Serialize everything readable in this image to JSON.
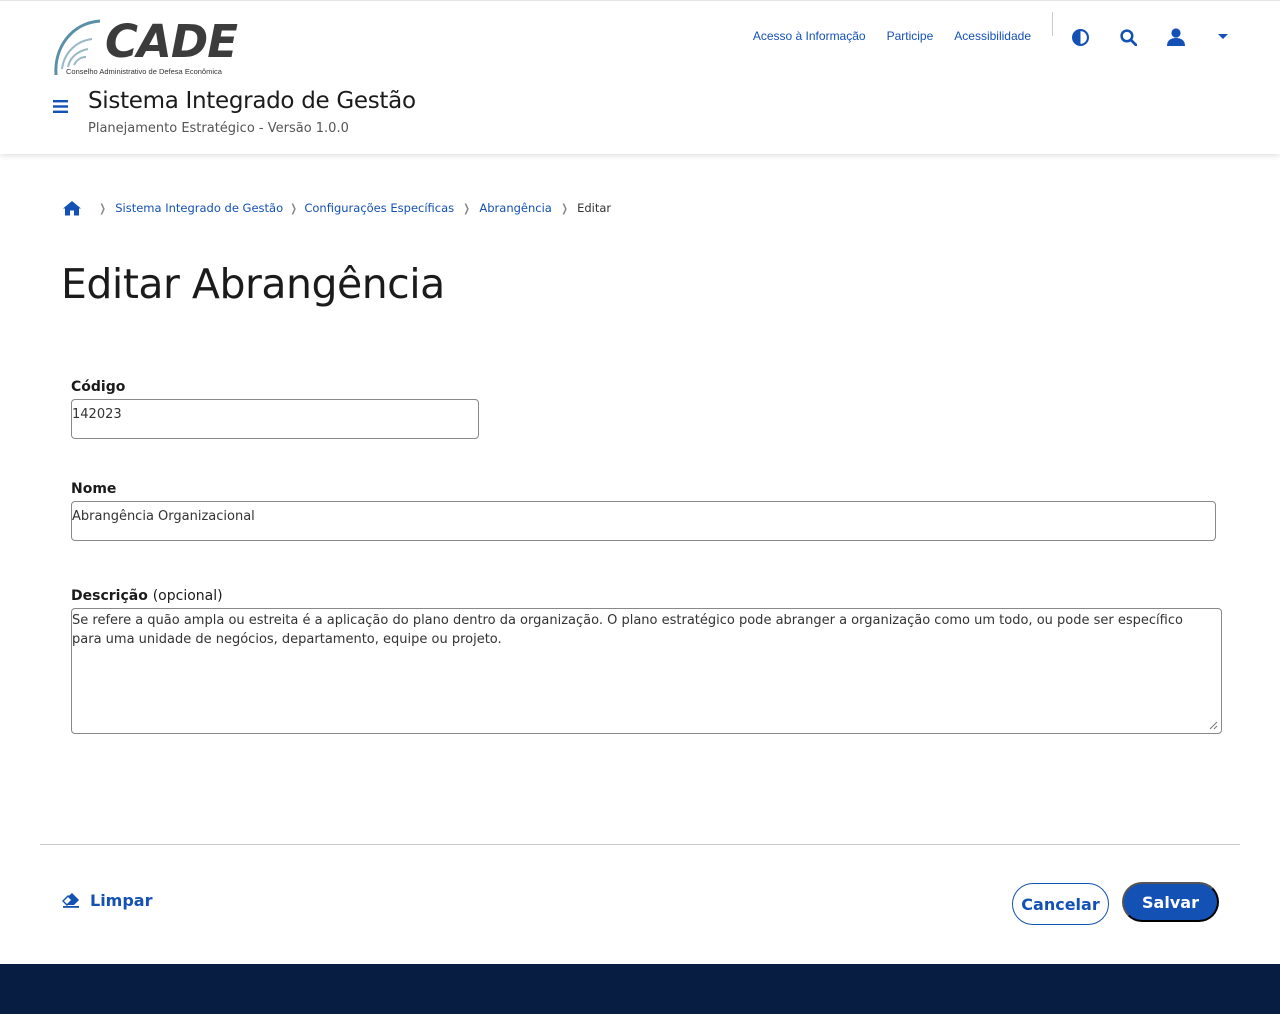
{
  "brand": {
    "logo_word": "CADE",
    "logo_subtitle": "Conselho Administrativo de Defesa Econômica"
  },
  "header": {
    "links": [
      "Acesso à Informação",
      "Participe",
      "Acessibilidade"
    ],
    "title": "Sistema Integrado de Gestão",
    "subtitle": "Planejamento Estratégico - Versão 1.0.0",
    "icons": [
      "contrast-icon",
      "search-icon",
      "user-icon",
      "caret-down-icon",
      "menu-icon"
    ]
  },
  "breadcrumb": {
    "items": [
      "Sistema Integrado de Gestão",
      "Configurações Específicas",
      "Abrangência"
    ],
    "current": "Editar"
  },
  "page": {
    "title": "Editar Abrangência"
  },
  "form": {
    "codigo": {
      "label": "Código",
      "value": "142023"
    },
    "nome": {
      "label": "Nome",
      "value": "Abrangência Organizacional"
    },
    "descricao": {
      "label": "Descrição",
      "optional": "(opcional)",
      "value": "Se refere a quão ampla ou estreita é a aplicação do plano dentro da organização. O plano estratégico pode abranger a organização como um todo, ou pode ser específico para uma unidade de negócios, departamento, equipe ou projeto."
    }
  },
  "actions": {
    "clear": "Limpar",
    "cancel": "Cancelar",
    "save": "Salvar"
  },
  "colors": {
    "primary": "#1351b4",
    "footer": "#071d41",
    "border": "#888888"
  }
}
